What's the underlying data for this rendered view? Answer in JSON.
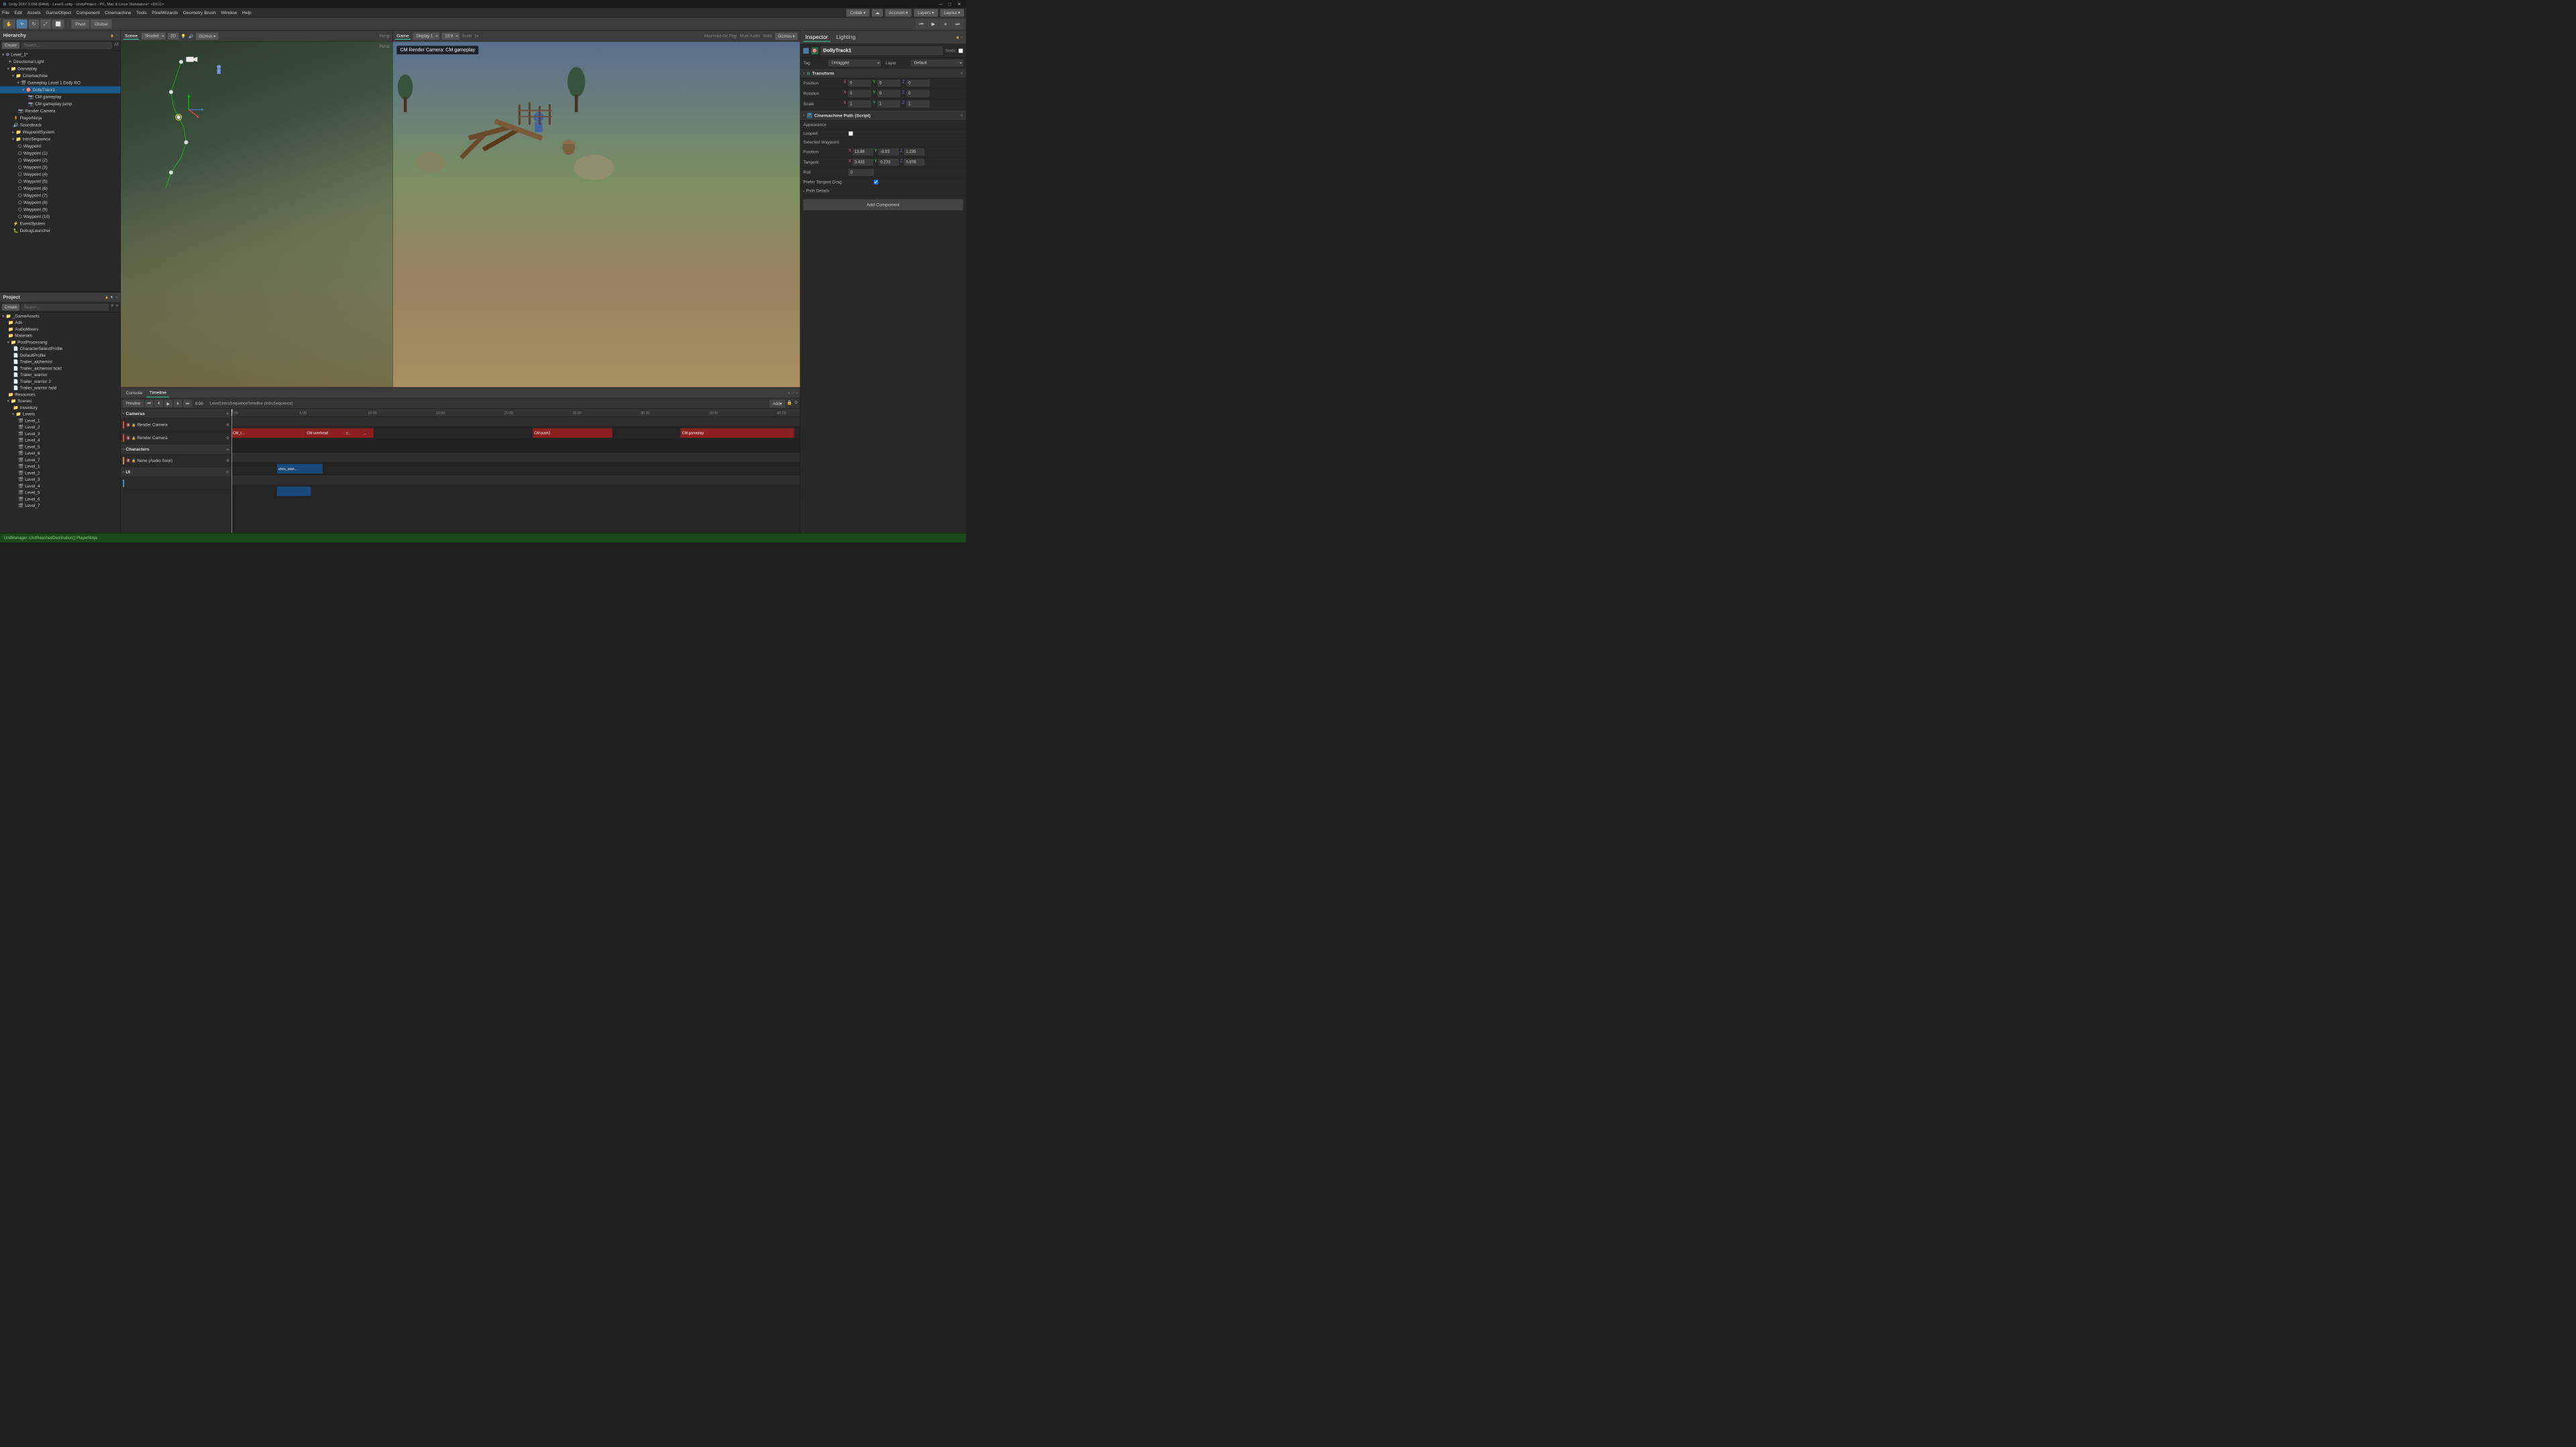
{
  "app": {
    "title": "Unity 2017.1.0b8 (64bit) - Level1.unity - UnityProject - PC, Mac & Linux Standalone* <DX11>",
    "menu_items": [
      "File",
      "Edit",
      "Assets",
      "GameObject",
      "Component",
      "Cinemachine",
      "Tools",
      "PixelWizards",
      "Geometry Brush",
      "Window",
      "Help"
    ]
  },
  "toolbar": {
    "pivot_label": "Pivot",
    "global_label": "Global",
    "collab_label": "Collab ▾",
    "account_label": "Account ▾",
    "layers_label": "Layers ▾",
    "layout_label": "Layout ▾"
  },
  "hierarchy": {
    "title": "Hierarchy",
    "create_label": "Create",
    "all_label": "All",
    "items": [
      {
        "label": "Level_1*",
        "indent": 0,
        "arrow": "▾",
        "type": "scene"
      },
      {
        "label": "Directional Light",
        "indent": 1,
        "arrow": "",
        "type": "light"
      },
      {
        "label": "Gameplay",
        "indent": 1,
        "arrow": "▾",
        "type": "group"
      },
      {
        "label": "Cinemachine",
        "indent": 2,
        "arrow": "▾",
        "type": "group"
      },
      {
        "label": "Gameplay Level 1 Dolly RO",
        "indent": 3,
        "arrow": "▾",
        "type": "obj"
      },
      {
        "label": "DollyTrack1",
        "indent": 4,
        "arrow": "▾",
        "type": "obj"
      },
      {
        "label": "CM gameplay",
        "indent": 5,
        "arrow": "",
        "type": "obj"
      },
      {
        "label": "CM gameplay jump",
        "indent": 5,
        "arrow": "",
        "type": "obj"
      },
      {
        "label": "Render Camera",
        "indent": 3,
        "arrow": "",
        "type": "camera"
      },
      {
        "label": "PlayerNinja",
        "indent": 2,
        "arrow": "",
        "type": "obj"
      },
      {
        "label": "Soundtrack",
        "indent": 2,
        "arrow": "",
        "type": "audio"
      },
      {
        "label": "WaypointSystem",
        "indent": 2,
        "arrow": "▾",
        "type": "group"
      },
      {
        "label": "IntroSequence",
        "indent": 2,
        "arrow": "▾",
        "type": "group"
      },
      {
        "label": "Waypoint",
        "indent": 3,
        "arrow": "",
        "type": "obj"
      },
      {
        "label": "Waypoint (1)",
        "indent": 3,
        "arrow": "",
        "type": "obj"
      },
      {
        "label": "Waypoint (2)",
        "indent": 3,
        "arrow": "",
        "type": "obj"
      },
      {
        "label": "Waypoint (3)",
        "indent": 3,
        "arrow": "",
        "type": "obj"
      },
      {
        "label": "Waypoint (4)",
        "indent": 3,
        "arrow": "",
        "type": "obj"
      },
      {
        "label": "Waypoint (5)",
        "indent": 3,
        "arrow": "",
        "type": "obj"
      },
      {
        "label": "Waypoint (6)",
        "indent": 3,
        "arrow": "",
        "type": "obj"
      },
      {
        "label": "Waypoint (7)",
        "indent": 3,
        "arrow": "",
        "type": "obj"
      },
      {
        "label": "Waypoint (8)",
        "indent": 3,
        "arrow": "",
        "type": "obj"
      },
      {
        "label": "Waypoint (9)",
        "indent": 3,
        "arrow": "",
        "type": "obj"
      },
      {
        "label": "Waypoint (10)",
        "indent": 3,
        "arrow": "",
        "type": "obj"
      },
      {
        "label": "EventSystem",
        "indent": 2,
        "arrow": "",
        "type": "obj"
      },
      {
        "label": "DebugLauncher",
        "indent": 2,
        "arrow": "",
        "type": "obj"
      }
    ]
  },
  "project": {
    "title": "Project",
    "create_label": "Create",
    "items": [
      {
        "label": "_GameAssets",
        "indent": 0,
        "arrow": "▾",
        "type": "folder"
      },
      {
        "label": "Ads",
        "indent": 1,
        "arrow": "",
        "type": "folder"
      },
      {
        "label": "AudioMixers",
        "indent": 1,
        "arrow": "",
        "type": "folder"
      },
      {
        "label": "Materials",
        "indent": 1,
        "arrow": "",
        "type": "folder"
      },
      {
        "label": "PostProcessing",
        "indent": 1,
        "arrow": "▾",
        "type": "folder"
      },
      {
        "label": "CharacterSelectProfile",
        "indent": 2,
        "arrow": "",
        "type": "file"
      },
      {
        "label": "DefaultProfile",
        "indent": 2,
        "arrow": "",
        "type": "file"
      },
      {
        "label": "Trailer_alchemist",
        "indent": 2,
        "arrow": "",
        "type": "file"
      },
      {
        "label": "Trailer_alchemist hold",
        "indent": 2,
        "arrow": "",
        "type": "file"
      },
      {
        "label": "Trailer_warrior",
        "indent": 2,
        "arrow": "",
        "type": "file"
      },
      {
        "label": "Trailer_warrior 2",
        "indent": 2,
        "arrow": "",
        "type": "file"
      },
      {
        "label": "Trailer_warrior hold",
        "indent": 2,
        "arrow": "",
        "type": "file"
      },
      {
        "label": "Resources",
        "indent": 1,
        "arrow": "",
        "type": "folder"
      },
      {
        "label": "Scenes",
        "indent": 1,
        "arrow": "▾",
        "type": "folder"
      },
      {
        "label": "Inventory",
        "indent": 2,
        "arrow": "",
        "type": "folder"
      },
      {
        "label": "Levels",
        "indent": 2,
        "arrow": "▾",
        "type": "folder"
      },
      {
        "label": "Level_1",
        "indent": 3,
        "arrow": "",
        "type": "file"
      },
      {
        "label": "Level_2",
        "indent": 3,
        "arrow": "",
        "type": "file"
      },
      {
        "label": "Level_3",
        "indent": 3,
        "arrow": "",
        "type": "file"
      },
      {
        "label": "Level_4",
        "indent": 3,
        "arrow": "",
        "type": "file"
      },
      {
        "label": "Level_5",
        "indent": 3,
        "arrow": "",
        "type": "file"
      },
      {
        "label": "Level_6",
        "indent": 3,
        "arrow": "",
        "type": "file"
      },
      {
        "label": "Level_7",
        "indent": 3,
        "arrow": "",
        "type": "file"
      },
      {
        "label": "Level_1",
        "indent": 3,
        "arrow": "",
        "type": "file"
      },
      {
        "label": "Level_2",
        "indent": 3,
        "arrow": "",
        "type": "file"
      },
      {
        "label": "Level_3",
        "indent": 3,
        "arrow": "",
        "type": "file"
      },
      {
        "label": "Level_4",
        "indent": 3,
        "arrow": "",
        "type": "file"
      },
      {
        "label": "Level_5",
        "indent": 3,
        "arrow": "",
        "type": "file"
      },
      {
        "label": "Level_6",
        "indent": 3,
        "arrow": "",
        "type": "file"
      },
      {
        "label": "Level_7",
        "indent": 3,
        "arrow": "",
        "type": "file"
      }
    ]
  },
  "scene": {
    "tab_label": "Scene",
    "mode": "Shaded",
    "is_2d": "2D",
    "persp_label": "Persp"
  },
  "game": {
    "tab_label": "Game",
    "display": "Display 1",
    "aspect": "16:9",
    "scale_label": "Scale",
    "scale_value": "1",
    "maximize_label": "Maximize On Play",
    "mute_label": "Mute Audio",
    "stats_label": "Stats",
    "gizmos_label": "Gizmos ▾",
    "cm_render_label": "CM Render Camera: CM gameplay"
  },
  "inspector": {
    "title": "Inspector",
    "lighting_tab": "Lighting",
    "object_name": "DollyTrack1",
    "static_label": "Static",
    "tag_label": "Tag",
    "tag_value": "Untagged",
    "layer_label": "Layer",
    "layer_value": "Default",
    "transform": {
      "title": "Transform",
      "position_label": "Position",
      "rotation_label": "Rotation",
      "scale_label": "Scale",
      "pos_x": "0",
      "pos_y": "0",
      "pos_z": "0",
      "rot_x": "0",
      "rot_y": "0",
      "rot_z": "0",
      "scale_x": "1",
      "scale_y": "1",
      "scale_z": "1"
    },
    "cinemachine": {
      "title": "Cinemachine Path (Script)",
      "appearance_label": "Appearance",
      "looped_label": "Looped",
      "selected_waypoint_label": "Selected Waypoint:",
      "position_label": "Position",
      "pos_x": "13.88",
      "pos_y": "-9.93",
      "pos_z": "1.235",
      "tangent_label": "Tangent",
      "tan_x": "3.433",
      "tan_y": "0.233",
      "tan_z": "0.878",
      "roll_label": "Roll",
      "roll_value": "0",
      "prefer_tangent_drag": "Prefer Tangent Drag",
      "path_details_label": "Path Details"
    },
    "add_component_label": "Add Component"
  },
  "timeline": {
    "console_tab": "Console",
    "timeline_tab": "Timeline",
    "preview_label": "Preview",
    "time_value": "0:00",
    "sequence_name": "Level1IntroSequenceTimeline (IntroSequence)",
    "add_label": "Add▾",
    "ruler_marks": [
      "0:00",
      "5:00",
      "10:00",
      "15:00",
      "20:00",
      "25:00",
      "30:00",
      "35:00",
      "40:00"
    ],
    "sections": [
      {
        "name": "Cameras",
        "tracks": [
          {
            "label": "Render Camera",
            "clips": [
              {
                "label": "CM_I...",
                "type": "red",
                "left": "0%",
                "width": "15%"
              },
              {
                "label": "CM overhead",
                "type": "red",
                "left": "15%",
                "width": "8%"
              },
              {
                "label": "C...",
                "type": "red",
                "left": "23%",
                "width": "4%"
              },
              {
                "label": "...",
                "type": "red",
                "left": "27%",
                "width": "2%"
              },
              {
                "label": "CM push2",
                "type": "red",
                "left": "55%",
                "width": "12%"
              },
              {
                "label": "CM gameplay",
                "type": "red",
                "left": "80%",
                "width": "18%"
              }
            ]
          },
          {
            "label": "Render Camera",
            "clips": []
          }
        ]
      },
      {
        "name": "Characters",
        "tracks": [
          {
            "label": "None (Audio Sour)",
            "clips": [
              {
                "label": "vocs_over...",
                "type": "blue",
                "left": "8%",
                "width": "8%"
              }
            ]
          }
        ]
      },
      {
        "name": "UI",
        "tracks": [
          {
            "label": "",
            "clips": [
              {
                "label": "",
                "type": "blue",
                "left": "8%",
                "width": "6%"
              }
            ]
          }
        ]
      }
    ]
  },
  "status_bar": {
    "message": "UnitManager::UnitReachedDestination() PlayerNinja"
  }
}
